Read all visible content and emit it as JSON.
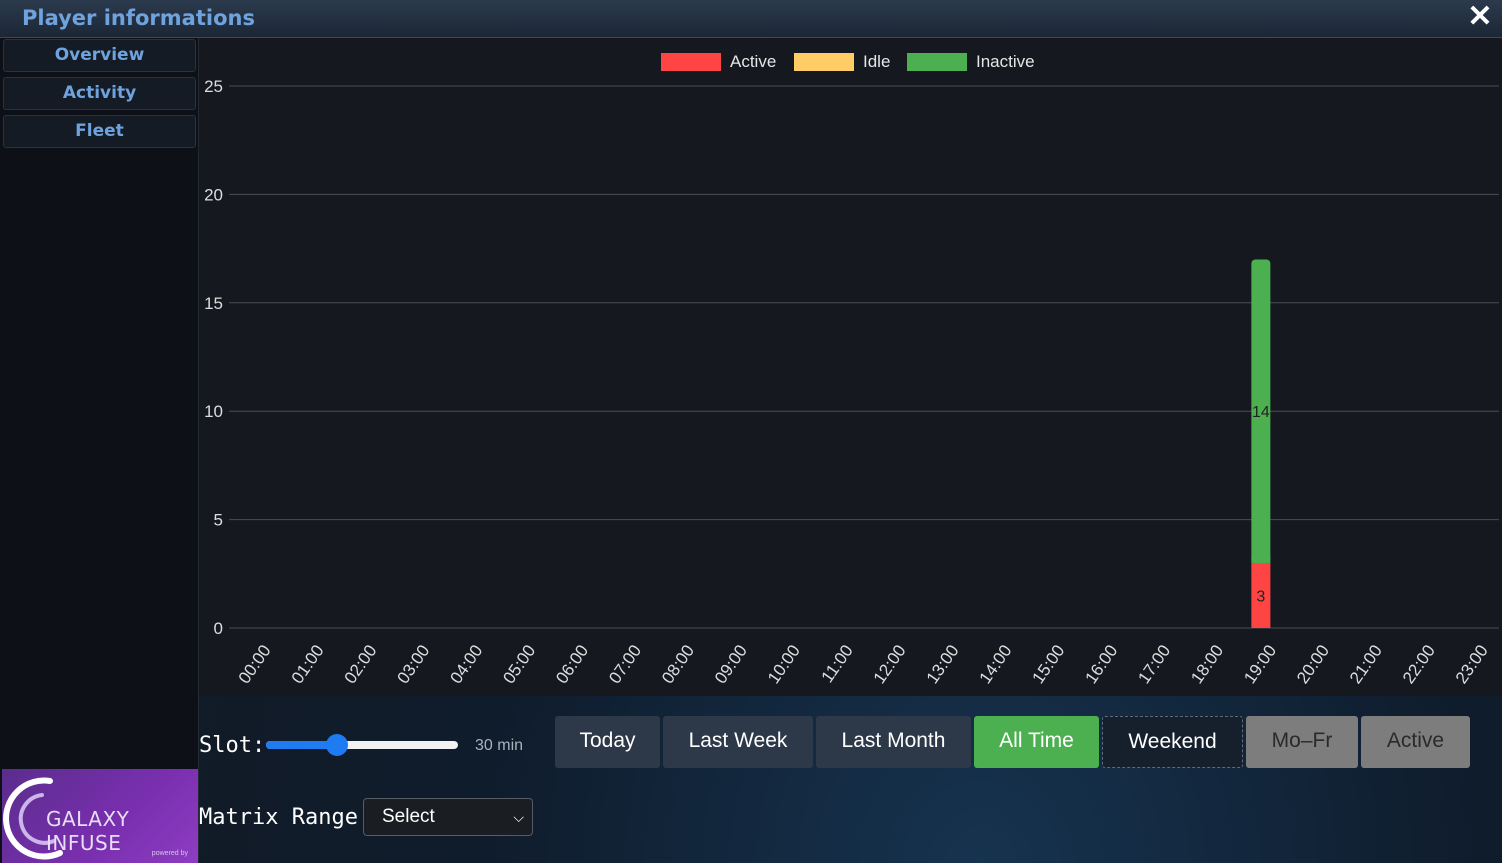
{
  "window": {
    "title": "Player informations",
    "close_icon": "close-icon"
  },
  "sidebar": {
    "items": [
      {
        "label": "Overview"
      },
      {
        "label": "Activity"
      },
      {
        "label": "Fleet"
      }
    ],
    "logo": {
      "text": "GALAXY INFUSE",
      "subtext": "powered by"
    }
  },
  "chart_data": {
    "type": "bar",
    "stacked": true,
    "categories": [
      "00:00",
      "01:00",
      "02:00",
      "03:00",
      "04:00",
      "05:00",
      "06:00",
      "07:00",
      "08:00",
      "09:00",
      "10:00",
      "11:00",
      "12:00",
      "13:00",
      "14:00",
      "15:00",
      "16:00",
      "17:00",
      "18:00",
      "19:00",
      "20:00",
      "21:00",
      "22:00",
      "23:00"
    ],
    "series": [
      {
        "name": "Active",
        "color": "#ff4444",
        "values": [
          0,
          0,
          0,
          0,
          0,
          0,
          0,
          0,
          0,
          0,
          0,
          0,
          0,
          0,
          0,
          0,
          0,
          0,
          0,
          3,
          0,
          0,
          0,
          0
        ]
      },
      {
        "name": "Idle",
        "color": "#ffcc66",
        "values": [
          0,
          0,
          0,
          0,
          0,
          0,
          0,
          0,
          0,
          0,
          0,
          0,
          0,
          0,
          0,
          0,
          0,
          0,
          0,
          0,
          0,
          0,
          0,
          0
        ]
      },
      {
        "name": "Inactive",
        "color": "#4caf50",
        "values": [
          0,
          0,
          0,
          0,
          0,
          0,
          0,
          0,
          0,
          0,
          0,
          0,
          0,
          0,
          0,
          0,
          0,
          0,
          0,
          14,
          0,
          0,
          0,
          0
        ]
      }
    ],
    "yticks": [
      0,
      5,
      10,
      15,
      20,
      25
    ],
    "ylim": [
      0,
      25
    ],
    "legend_position": "top-center",
    "grid": true
  },
  "controls": {
    "slot_label": "Slot:",
    "slot_value": "30 min",
    "slot_fraction": 0.35,
    "buttons": [
      {
        "label": "Today",
        "state": "normal"
      },
      {
        "label": "Last Week",
        "state": "normal"
      },
      {
        "label": "Last Month",
        "state": "normal"
      },
      {
        "label": "All Time",
        "state": "selected"
      },
      {
        "label": "Weekend",
        "state": "outlined"
      },
      {
        "label": "Mo–Fr",
        "state": "disabled"
      },
      {
        "label": "Active",
        "state": "disabled"
      }
    ],
    "matrix_label": "Matrix Range:",
    "matrix_select": "Select"
  },
  "colors": {
    "accent_blue": "#6fa3de",
    "selected_green": "#4caf50",
    "button_dark": "#2d3848",
    "button_disabled": "#7d7d7d"
  }
}
